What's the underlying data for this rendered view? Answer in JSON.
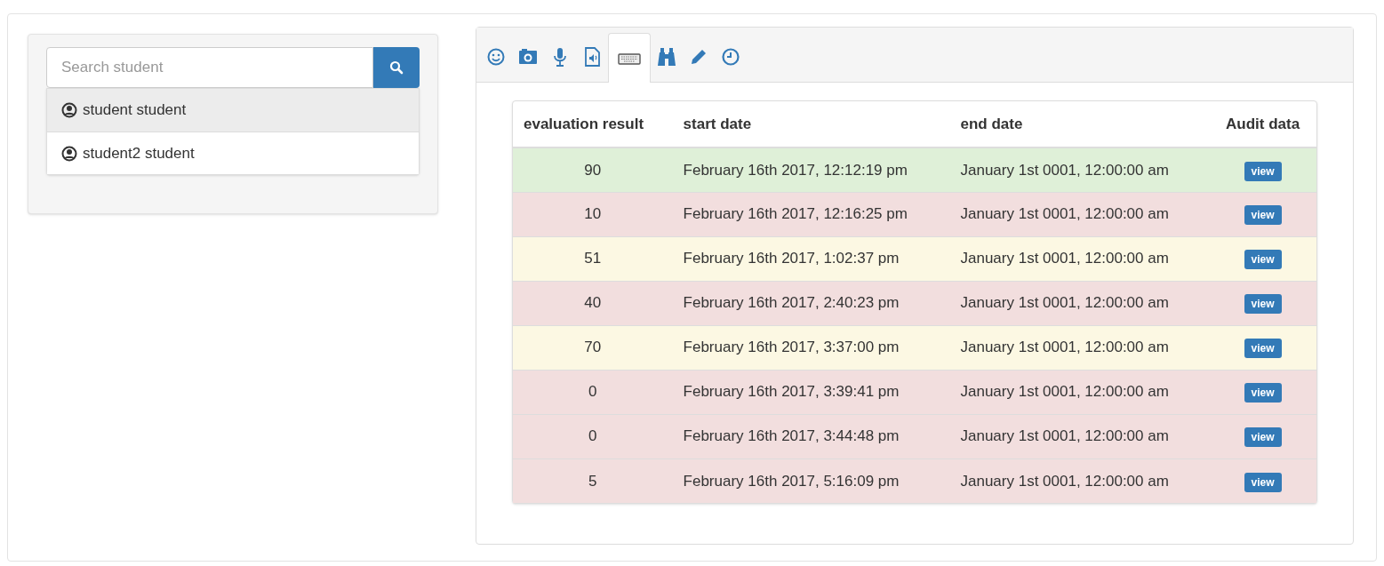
{
  "search": {
    "placeholder": "Search student"
  },
  "students": [
    {
      "name": "student student",
      "selected": true
    },
    {
      "name": "student2 student",
      "selected": false
    }
  ],
  "tabs": [
    {
      "kind": "smiley",
      "selected": false
    },
    {
      "kind": "camera",
      "selected": false
    },
    {
      "kind": "microphone",
      "selected": false
    },
    {
      "kind": "audio-file",
      "selected": false
    },
    {
      "kind": "keyboard",
      "selected": true
    },
    {
      "kind": "binoculars",
      "selected": false
    },
    {
      "kind": "pencil",
      "selected": false
    },
    {
      "kind": "clock",
      "selected": false
    }
  ],
  "table": {
    "columns": [
      "evaluation result",
      "start date",
      "end date",
      "Audit data"
    ],
    "rows": [
      {
        "color": "#dff0d8",
        "result": "90",
        "start": "February 16th 2017, 12:12:19 pm",
        "end": "January 1st 0001, 12:00:00 am",
        "action": "view"
      },
      {
        "color": "#f2dede",
        "result": "10",
        "start": "February 16th 2017, 12:16:25 pm",
        "end": "January 1st 0001, 12:00:00 am",
        "action": "view"
      },
      {
        "color": "#fcf8e3",
        "result": "51",
        "start": "February 16th 2017, 1:02:37 pm",
        "end": "January 1st 0001, 12:00:00 am",
        "action": "view"
      },
      {
        "color": "#f2dede",
        "result": "40",
        "start": "February 16th 2017, 2:40:23 pm",
        "end": "January 1st 0001, 12:00:00 am",
        "action": "view"
      },
      {
        "color": "#fcf8e3",
        "result": "70",
        "start": "February 16th 2017, 3:37:00 pm",
        "end": "January 1st 0001, 12:00:00 am",
        "action": "view"
      },
      {
        "color": "#f2dede",
        "result": "0",
        "start": "February 16th 2017, 3:39:41 pm",
        "end": "January 1st 0001, 12:00:00 am",
        "action": "view"
      },
      {
        "color": "#f2dede",
        "result": "0",
        "start": "February 16th 2017, 3:44:48 pm",
        "end": "January 1st 0001, 12:00:00 am",
        "action": "view"
      },
      {
        "color": "#f2dede",
        "result": "5",
        "start": "February 16th 2017, 5:16:09 pm",
        "end": "January 1st 0001, 12:00:00 am",
        "action": "view"
      }
    ]
  }
}
